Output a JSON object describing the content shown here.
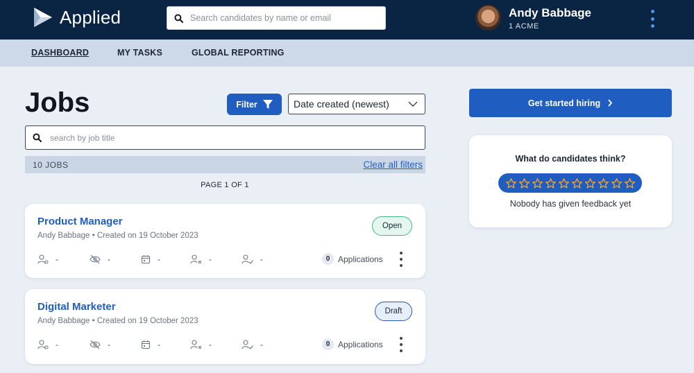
{
  "app": {
    "name": "Applied"
  },
  "header": {
    "search_placeholder": "Search candidates by name or email",
    "user": {
      "name": "Andy Babbage",
      "org": "1 ACME"
    }
  },
  "nav": {
    "items": [
      {
        "label": "DASHBOARD",
        "active": true
      },
      {
        "label": "MY TASKS",
        "active": false
      },
      {
        "label": "GLOBAL REPORTING",
        "active": false
      }
    ]
  },
  "jobs": {
    "title": "Jobs",
    "filter_label": "Filter",
    "sort_value": "Date created (newest)",
    "search_placeholder": "search by job title",
    "count_label": "10 JOBS",
    "clear_filters_label": "Clear all filters",
    "page_info": "PAGE 1 OF 1",
    "list": [
      {
        "title": "Product Manager",
        "meta": "Andy Babbage • Created on 19 October 2023",
        "status": "Open",
        "stats": [
          "-",
          "-",
          "-",
          "-",
          "-"
        ],
        "applications_count": "0",
        "applications_label": "Applications"
      },
      {
        "title": "Digital Marketer",
        "meta": "Andy Babbage • Created on 19 October 2023",
        "status": "Draft",
        "stats": [
          "-",
          "-",
          "-",
          "-",
          "-"
        ],
        "applications_count": "0",
        "applications_label": "Applications"
      }
    ]
  },
  "sidebar": {
    "cta_label": "Get started hiring",
    "feedback": {
      "title": "What do candidates think?",
      "star_count": 10,
      "empty_text": "Nobody has given feedback yet"
    }
  },
  "colors": {
    "header_bg": "#0a2444",
    "nav_bg": "#cdd9e8",
    "primary": "#1f5dc0",
    "open_badge": "#43b988",
    "star_outline": "#f2a93b"
  },
  "icons": [
    "applied-logo-icon",
    "search-icon",
    "kebab-menu-icon",
    "filter-icon",
    "chevron-down-icon",
    "chevron-right-icon",
    "candidates-icon",
    "hidden-icon",
    "calendar-icon",
    "rejected-icon",
    "hired-icon",
    "star-icon"
  ]
}
